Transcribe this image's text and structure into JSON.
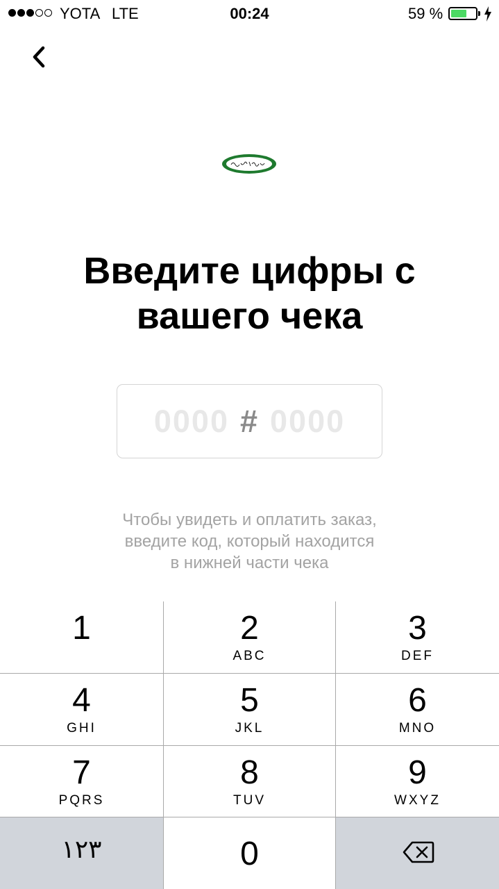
{
  "status_bar": {
    "carrier": "YOTA",
    "network": "LTE",
    "time": "00:24",
    "battery_percent": "59 %",
    "battery_level": 0.59,
    "signal_bars_filled": 3,
    "signal_bars_total": 5
  },
  "icons": {
    "back": "chevron-left-icon",
    "logo": "brand-logo-icon",
    "delete": "backspace-icon"
  },
  "colors": {
    "battery_fill": "#4cd964",
    "logo_green": "#1e7a2e",
    "keypad_grey": "#d1d5db",
    "hint_text": "#a3a3a3"
  },
  "title_line1": "Введите цифры с",
  "title_line2": "вашего чека",
  "code": {
    "placeholder_left": "0000",
    "separator": "#",
    "placeholder_right": "0000"
  },
  "hint": {
    "line1": "Чтобы увидеть и оплатить заказ,",
    "line2": "введите код, который находится",
    "line3": "в нижней части чека"
  },
  "keypad": {
    "keys": [
      {
        "num": "1",
        "letters": ""
      },
      {
        "num": "2",
        "letters": "ABC"
      },
      {
        "num": "3",
        "letters": "DEF"
      },
      {
        "num": "4",
        "letters": "GHI"
      },
      {
        "num": "5",
        "letters": "JKL"
      },
      {
        "num": "6",
        "letters": "MNO"
      },
      {
        "num": "7",
        "letters": "PQRS"
      },
      {
        "num": "8",
        "letters": "TUV"
      },
      {
        "num": "9",
        "letters": "WXYZ"
      },
      {
        "num": "0",
        "letters": ""
      }
    ],
    "alt_label": "١٢٣"
  }
}
